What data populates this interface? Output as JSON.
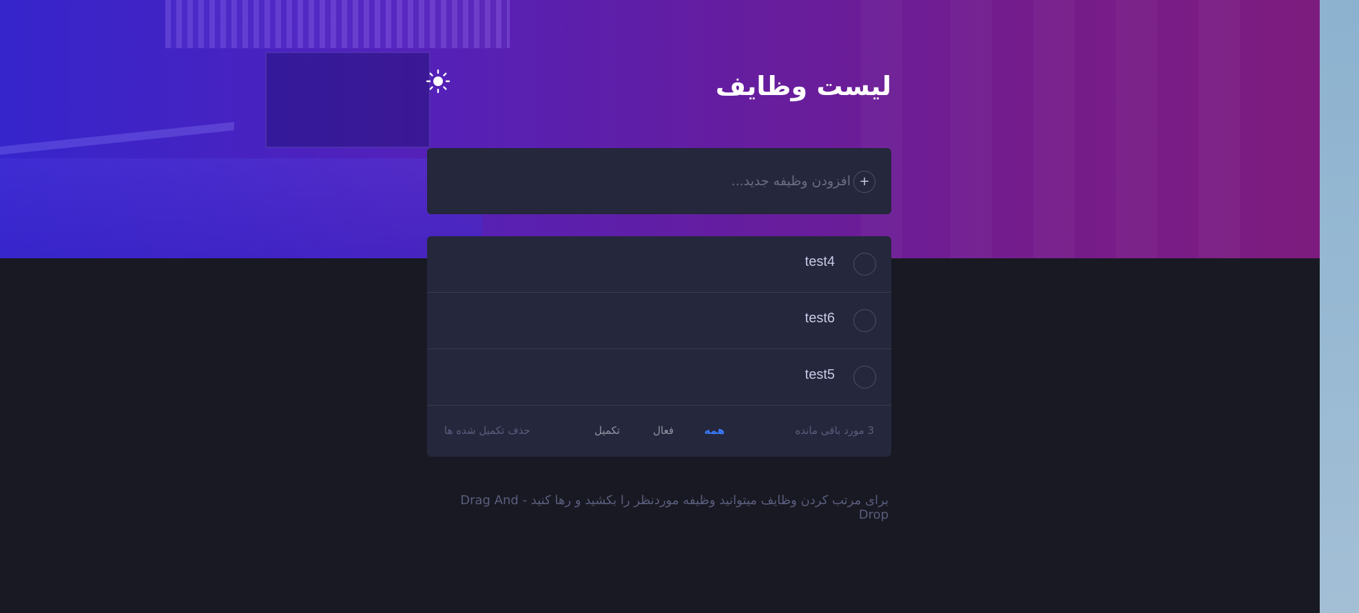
{
  "colors": {
    "background": "#181922",
    "card": "#25273c",
    "accent": "#3a7bfd",
    "text": "#c8cbe7",
    "muted": "#5b5e7e"
  },
  "header": {
    "title": "لیست وظایف",
    "theme_icon": "sun-icon"
  },
  "new_todo": {
    "placeholder": "افزودن وظیفه جدید...",
    "value": "",
    "add_icon": "plus-icon",
    "add_label": "+"
  },
  "todos": [
    {
      "text": "test4",
      "completed": false
    },
    {
      "text": "test6",
      "completed": false
    },
    {
      "text": "test5",
      "completed": false
    }
  ],
  "footer": {
    "remaining": "3 مورد باقی مانده",
    "filter_all": "همه",
    "filter_active": "فعال",
    "filter_completed": "تکمیل",
    "selected_filter": "همه",
    "clear_completed": "حذف تکمیل شده ها"
  },
  "hint": "برای مرتب کردن وظایف میتوانید وظیفه موردنظر را بکشید و رها کنید - Drag And Drop"
}
